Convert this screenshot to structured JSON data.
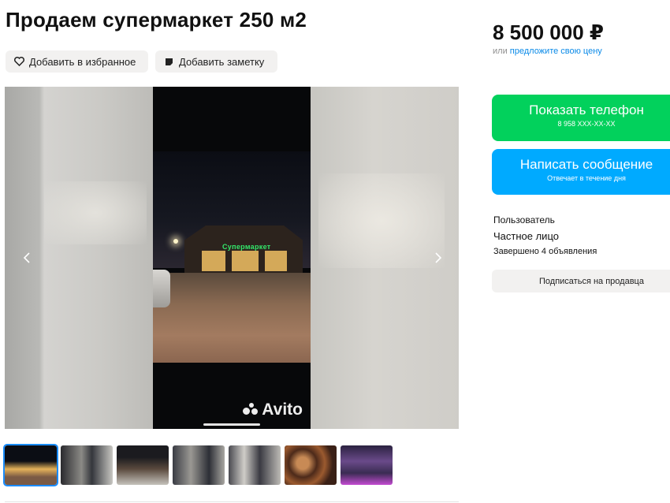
{
  "listing": {
    "title": "Продаем супермаркет 250 м2"
  },
  "actions": {
    "favorite_label": "Добавить в избранное",
    "note_label": "Добавить заметку"
  },
  "gallery": {
    "store_sign": "Супермаркет",
    "logo_text": "Avito",
    "thumbnail_count": 7,
    "active_thumbnail": 1
  },
  "price": {
    "value": "8 500 000 ₽",
    "offer_prefix": "или",
    "offer_link": "предложите свою цену"
  },
  "contact": {
    "phone_label": "Показать телефон",
    "phone_masked": "8 958 XXX-XX-XX",
    "message_label": "Написать сообщение",
    "message_sub": "Отвечает в течение дня"
  },
  "seller": {
    "name": "Пользователь",
    "type": "Частное лицо",
    "completed": "Завершено 4 объявления",
    "subscribe_label": "Подписаться на продавца"
  },
  "colors": {
    "phone_button": "#02d15c",
    "message_button": "#00aaff",
    "link": "#0a8ae8"
  }
}
